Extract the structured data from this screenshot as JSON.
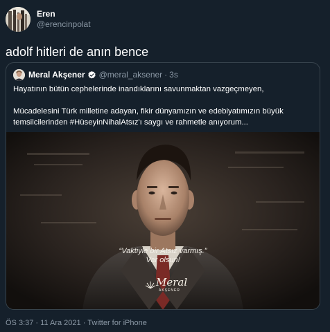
{
  "tweet": {
    "author_name": "Eren",
    "author_handle": "@erencinpolat",
    "text": "adolf hitleri de anın bence",
    "avatar_icon": "profile-photo-icon"
  },
  "quoted_tweet": {
    "author_name": "Meral Akşener",
    "verified_icon": "verified-badge-icon",
    "author_handle": "@meral_aksener",
    "separator": "·",
    "time": "3s",
    "lines": [
      "Hayatının bütün cephelerinde inandıklarını savunmaktan vazgeçmeyen,",
      "",
      "Mücadelesini Türk milletine adayan, fikir dünyamızın ve edebiyatımızın büyük",
      "temsilcilerinden #HüseyinNihalAtsız'ı saygı ve rahmetle anıyorum..."
    ],
    "media": {
      "caption_line1": "“Vaktiyle bir Atsız varmış.”",
      "caption_line2": "Var olsun!",
      "signature": "Meral",
      "signature_sub": "AKŞENER"
    }
  },
  "footer": {
    "time": "ÖS 3:37",
    "separator1": " · ",
    "date": "11 Ara 2021",
    "separator2": " · ",
    "client": "Twitter for iPhone"
  },
  "colors": {
    "background": "#15202b",
    "text": "#ffffff",
    "secondary_text": "#8b98a5",
    "border": "#38444d",
    "verified": "#ffffff"
  }
}
